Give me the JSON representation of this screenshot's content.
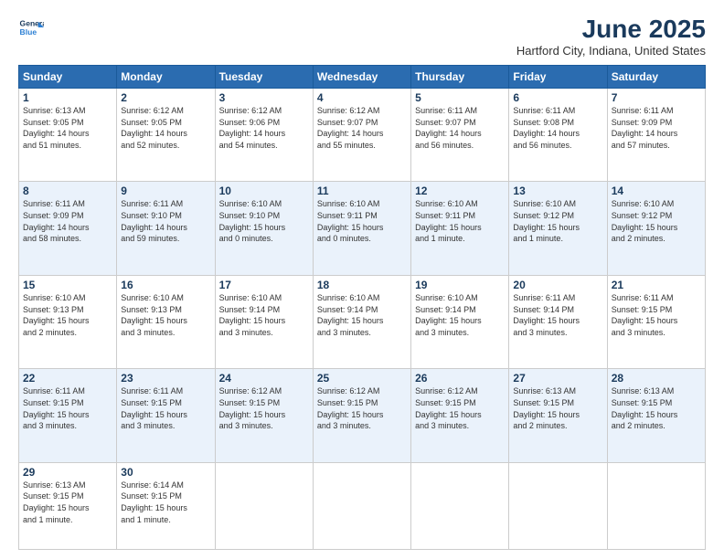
{
  "header": {
    "logo_line1": "General",
    "logo_line2": "Blue",
    "month": "June 2025",
    "location": "Hartford City, Indiana, United States"
  },
  "days_of_week": [
    "Sunday",
    "Monday",
    "Tuesday",
    "Wednesday",
    "Thursday",
    "Friday",
    "Saturday"
  ],
  "weeks": [
    [
      {
        "day": "1",
        "info": "Sunrise: 6:13 AM\nSunset: 9:05 PM\nDaylight: 14 hours\nand 51 minutes."
      },
      {
        "day": "2",
        "info": "Sunrise: 6:12 AM\nSunset: 9:05 PM\nDaylight: 14 hours\nand 52 minutes."
      },
      {
        "day": "3",
        "info": "Sunrise: 6:12 AM\nSunset: 9:06 PM\nDaylight: 14 hours\nand 54 minutes."
      },
      {
        "day": "4",
        "info": "Sunrise: 6:12 AM\nSunset: 9:07 PM\nDaylight: 14 hours\nand 55 minutes."
      },
      {
        "day": "5",
        "info": "Sunrise: 6:11 AM\nSunset: 9:07 PM\nDaylight: 14 hours\nand 56 minutes."
      },
      {
        "day": "6",
        "info": "Sunrise: 6:11 AM\nSunset: 9:08 PM\nDaylight: 14 hours\nand 56 minutes."
      },
      {
        "day": "7",
        "info": "Sunrise: 6:11 AM\nSunset: 9:09 PM\nDaylight: 14 hours\nand 57 minutes."
      }
    ],
    [
      {
        "day": "8",
        "info": "Sunrise: 6:11 AM\nSunset: 9:09 PM\nDaylight: 14 hours\nand 58 minutes."
      },
      {
        "day": "9",
        "info": "Sunrise: 6:11 AM\nSunset: 9:10 PM\nDaylight: 14 hours\nand 59 minutes."
      },
      {
        "day": "10",
        "info": "Sunrise: 6:10 AM\nSunset: 9:10 PM\nDaylight: 15 hours\nand 0 minutes."
      },
      {
        "day": "11",
        "info": "Sunrise: 6:10 AM\nSunset: 9:11 PM\nDaylight: 15 hours\nand 0 minutes."
      },
      {
        "day": "12",
        "info": "Sunrise: 6:10 AM\nSunset: 9:11 PM\nDaylight: 15 hours\nand 1 minute."
      },
      {
        "day": "13",
        "info": "Sunrise: 6:10 AM\nSunset: 9:12 PM\nDaylight: 15 hours\nand 1 minute."
      },
      {
        "day": "14",
        "info": "Sunrise: 6:10 AM\nSunset: 9:12 PM\nDaylight: 15 hours\nand 2 minutes."
      }
    ],
    [
      {
        "day": "15",
        "info": "Sunrise: 6:10 AM\nSunset: 9:13 PM\nDaylight: 15 hours\nand 2 minutes."
      },
      {
        "day": "16",
        "info": "Sunrise: 6:10 AM\nSunset: 9:13 PM\nDaylight: 15 hours\nand 3 minutes."
      },
      {
        "day": "17",
        "info": "Sunrise: 6:10 AM\nSunset: 9:14 PM\nDaylight: 15 hours\nand 3 minutes."
      },
      {
        "day": "18",
        "info": "Sunrise: 6:10 AM\nSunset: 9:14 PM\nDaylight: 15 hours\nand 3 minutes."
      },
      {
        "day": "19",
        "info": "Sunrise: 6:10 AM\nSunset: 9:14 PM\nDaylight: 15 hours\nand 3 minutes."
      },
      {
        "day": "20",
        "info": "Sunrise: 6:11 AM\nSunset: 9:14 PM\nDaylight: 15 hours\nand 3 minutes."
      },
      {
        "day": "21",
        "info": "Sunrise: 6:11 AM\nSunset: 9:15 PM\nDaylight: 15 hours\nand 3 minutes."
      }
    ],
    [
      {
        "day": "22",
        "info": "Sunrise: 6:11 AM\nSunset: 9:15 PM\nDaylight: 15 hours\nand 3 minutes."
      },
      {
        "day": "23",
        "info": "Sunrise: 6:11 AM\nSunset: 9:15 PM\nDaylight: 15 hours\nand 3 minutes."
      },
      {
        "day": "24",
        "info": "Sunrise: 6:12 AM\nSunset: 9:15 PM\nDaylight: 15 hours\nand 3 minutes."
      },
      {
        "day": "25",
        "info": "Sunrise: 6:12 AM\nSunset: 9:15 PM\nDaylight: 15 hours\nand 3 minutes."
      },
      {
        "day": "26",
        "info": "Sunrise: 6:12 AM\nSunset: 9:15 PM\nDaylight: 15 hours\nand 3 minutes."
      },
      {
        "day": "27",
        "info": "Sunrise: 6:13 AM\nSunset: 9:15 PM\nDaylight: 15 hours\nand 2 minutes."
      },
      {
        "day": "28",
        "info": "Sunrise: 6:13 AM\nSunset: 9:15 PM\nDaylight: 15 hours\nand 2 minutes."
      }
    ],
    [
      {
        "day": "29",
        "info": "Sunrise: 6:13 AM\nSunset: 9:15 PM\nDaylight: 15 hours\nand 1 minute."
      },
      {
        "day": "30",
        "info": "Sunrise: 6:14 AM\nSunset: 9:15 PM\nDaylight: 15 hours\nand 1 minute."
      },
      {
        "day": "",
        "info": ""
      },
      {
        "day": "",
        "info": ""
      },
      {
        "day": "",
        "info": ""
      },
      {
        "day": "",
        "info": ""
      },
      {
        "day": "",
        "info": ""
      }
    ]
  ]
}
